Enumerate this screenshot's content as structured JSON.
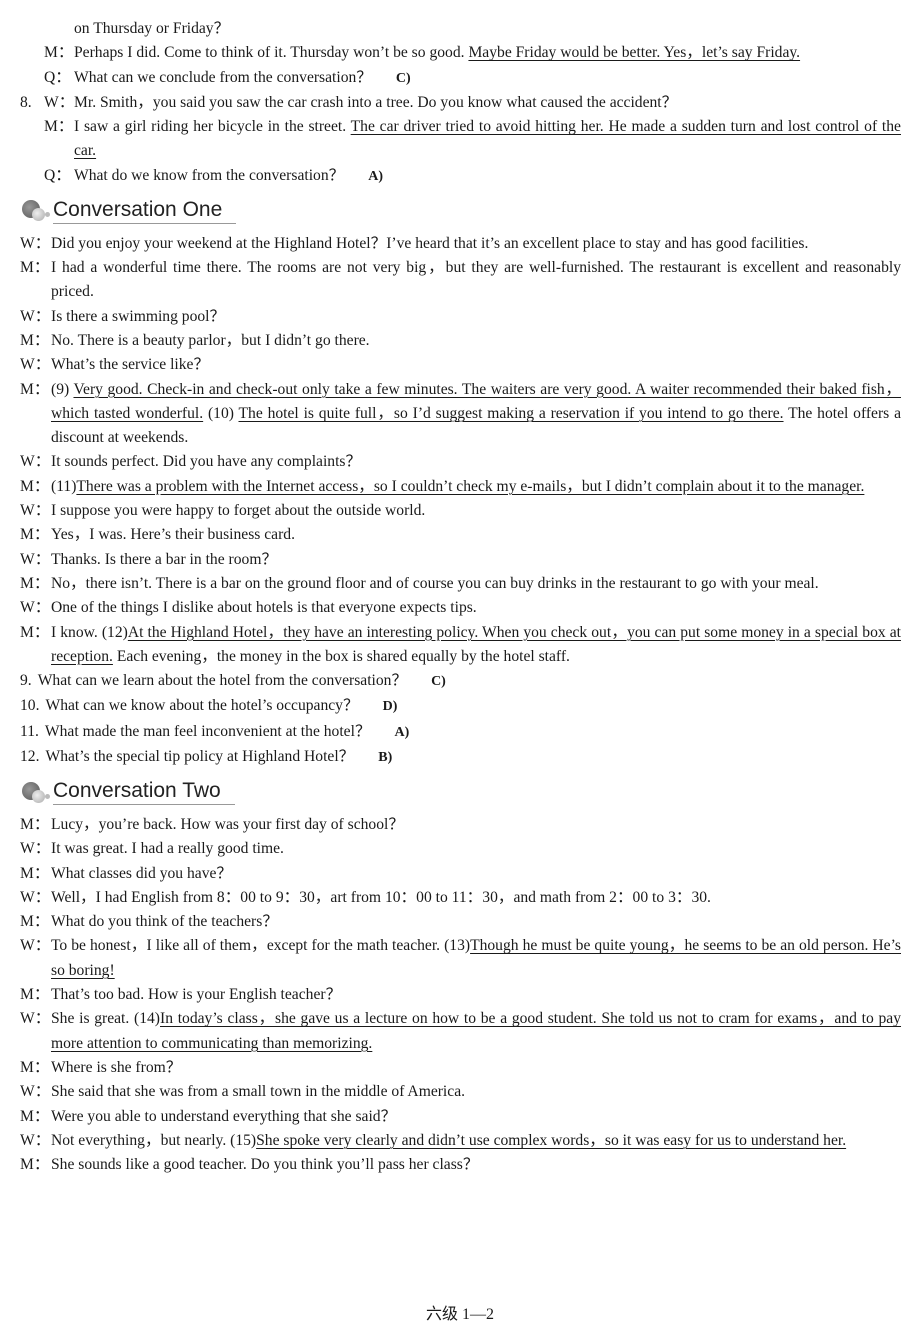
{
  "blocks": [
    {
      "kind": "top",
      "cont": true,
      "segs": [
        {
          "t": "on Thursday or Friday？"
        }
      ]
    },
    {
      "kind": "top",
      "spk": "M：",
      "segs": [
        {
          "t": "Perhaps I did. Come to think of it. Thursday won’t be so good. "
        },
        {
          "t": "Maybe Friday would be better. Yes，let’s say Friday.",
          "u": true
        }
      ]
    },
    {
      "kind": "top",
      "spk": "Q：",
      "segs": [
        {
          "t": "What can we conclude from the conversation？"
        }
      ],
      "ans": "C)"
    },
    {
      "kind": "top",
      "num": "8.",
      "spk": "W：",
      "segs": [
        {
          "t": "Mr. Smith，you said you saw the car crash into a tree. Do you know what caused the accident？"
        }
      ]
    },
    {
      "kind": "top",
      "spk": "M：",
      "segs": [
        {
          "t": "I saw a girl riding her bicycle in the street. "
        },
        {
          "t": "The car driver tried to avoid hitting her. He made a sudden turn and lost control of the car.",
          "u": true
        }
      ]
    },
    {
      "kind": "top",
      "spk": "Q：",
      "segs": [
        {
          "t": "What do we know from the conversation？"
        }
      ],
      "ans": "A)"
    },
    {
      "kind": "heading",
      "text": "Conversation One"
    },
    {
      "kind": "conv",
      "spk": "W：",
      "segs": [
        {
          "t": "Did you enjoy your weekend at the Highland Hotel？I’ve heard that it’s an excellent place to stay and has good facilities."
        }
      ]
    },
    {
      "kind": "conv",
      "spk": "M：",
      "segs": [
        {
          "t": "I had a wonderful time there. The rooms are not very big，but they are well-furnished. The restaurant is excellent and reasonably priced."
        }
      ]
    },
    {
      "kind": "conv",
      "spk": "W：",
      "segs": [
        {
          "t": "Is there a swimming pool？"
        }
      ]
    },
    {
      "kind": "conv",
      "spk": "M：",
      "segs": [
        {
          "t": "No. There is a beauty parlor，but I didn’t go there."
        }
      ]
    },
    {
      "kind": "conv",
      "spk": "W：",
      "segs": [
        {
          "t": "What’s the service like？"
        }
      ]
    },
    {
      "kind": "conv",
      "spk": "M：",
      "segs": [
        {
          "t": "(9) "
        },
        {
          "t": "Very good. Check-in and check-out only take a few minutes. The waiters are very good. A waiter recommended their baked fish，which tasted wonderful.",
          "u": true
        },
        {
          "t": " (10) "
        },
        {
          "t": "The hotel is quite full，so I’d suggest making a reservation if you intend to go there.",
          "u": true
        },
        {
          "t": " The hotel offers a discount at weekends."
        }
      ]
    },
    {
      "kind": "conv",
      "spk": "W：",
      "segs": [
        {
          "t": "It sounds perfect. Did you have any complaints？"
        }
      ]
    },
    {
      "kind": "conv",
      "spk": "M：",
      "segs": [
        {
          "t": "(11)"
        },
        {
          "t": "There was a problem with the Internet access，so I couldn’t check my e-mails，but I didn’t complain about it to the manager.",
          "u": true
        }
      ]
    },
    {
      "kind": "conv",
      "spk": "W：",
      "segs": [
        {
          "t": "I suppose you were happy to forget about the outside world."
        }
      ]
    },
    {
      "kind": "conv",
      "spk": "M：",
      "segs": [
        {
          "t": "Yes，I was. Here’s their business card."
        }
      ]
    },
    {
      "kind": "conv",
      "spk": "W：",
      "segs": [
        {
          "t": "Thanks. Is there a bar in the room？"
        }
      ]
    },
    {
      "kind": "conv",
      "spk": "M：",
      "segs": [
        {
          "t": "No，there isn’t. There is a bar on the ground floor and of course you can buy drinks in the restaurant to go with your meal."
        }
      ]
    },
    {
      "kind": "conv",
      "spk": "W：",
      "segs": [
        {
          "t": "One of the things I dislike about hotels is that everyone expects tips."
        }
      ]
    },
    {
      "kind": "conv",
      "spk": "M：",
      "segs": [
        {
          "t": "I know. (12)"
        },
        {
          "t": "At the Highland Hotel，they have an interesting policy. When you check out，you can put some money in a special box at reception.",
          "u": true
        },
        {
          "t": " Each evening，the money in the box is shared equally by the hotel staff."
        }
      ]
    },
    {
      "kind": "q",
      "num": "9.",
      "segs": [
        {
          "t": "What can we learn about the hotel from the conversation？"
        }
      ],
      "ans": "C)"
    },
    {
      "kind": "q",
      "num": "10.",
      "segs": [
        {
          "t": "What can we know about the hotel’s occupancy？"
        }
      ],
      "ans": "D)"
    },
    {
      "kind": "q",
      "num": "11.",
      "segs": [
        {
          "t": "What made the man feel inconvenient at the hotel？"
        }
      ],
      "ans": "A)"
    },
    {
      "kind": "q",
      "num": "12.",
      "segs": [
        {
          "t": "What’s the special tip policy at Highland Hotel？"
        }
      ],
      "ans": "B)"
    },
    {
      "kind": "heading",
      "text": "Conversation Two"
    },
    {
      "kind": "conv",
      "spk": "M：",
      "segs": [
        {
          "t": "Lucy，you’re back. How was your first day of school？"
        }
      ]
    },
    {
      "kind": "conv",
      "spk": "W：",
      "segs": [
        {
          "t": "It was great. I had a really good time."
        }
      ]
    },
    {
      "kind": "conv",
      "spk": "M：",
      "segs": [
        {
          "t": "What classes did you have？"
        }
      ]
    },
    {
      "kind": "conv",
      "spk": "W：",
      "segs": [
        {
          "t": "Well，I had English from 8：00 to 9：30，art from 10：00 to 11：30，and math from 2：00 to 3：30."
        }
      ]
    },
    {
      "kind": "conv",
      "spk": "M：",
      "segs": [
        {
          "t": "What do you think of the teachers？"
        }
      ]
    },
    {
      "kind": "conv",
      "spk": "W：",
      "segs": [
        {
          "t": "To be honest，I like all of them，except for the math teacher. (13)"
        },
        {
          "t": "Though he must be quite young，he seems to be an old person. He’s so boring!",
          "u": true
        }
      ]
    },
    {
      "kind": "conv",
      "spk": "M：",
      "segs": [
        {
          "t": "That’s too bad. How is your English teacher？"
        }
      ]
    },
    {
      "kind": "conv",
      "spk": "W：",
      "segs": [
        {
          "t": "She is great. (14)"
        },
        {
          "t": "In today’s class，she gave us a lecture on how to be a good student. She told us not to cram for exams，and to pay more attention to communicating than memorizing.",
          "u": true
        }
      ]
    },
    {
      "kind": "conv",
      "spk": "M：",
      "segs": [
        {
          "t": "Where is she from？"
        }
      ]
    },
    {
      "kind": "conv",
      "spk": "W：",
      "segs": [
        {
          "t": "She said that she was from a small town in the middle of America."
        }
      ]
    },
    {
      "kind": "conv",
      "spk": "M：",
      "segs": [
        {
          "t": "Were you able to understand everything that she said？"
        }
      ]
    },
    {
      "kind": "conv",
      "spk": "W：",
      "segs": [
        {
          "t": "Not everything，but nearly. (15)"
        },
        {
          "t": "She spoke very clearly and didn’t use complex words，so it was easy for us to understand her.",
          "u": true
        }
      ]
    },
    {
      "kind": "conv",
      "spk": "M：",
      "segs": [
        {
          "t": "She sounds like a good teacher. Do you think you’ll pass her class？"
        }
      ]
    }
  ],
  "footer": "六级 1—2"
}
